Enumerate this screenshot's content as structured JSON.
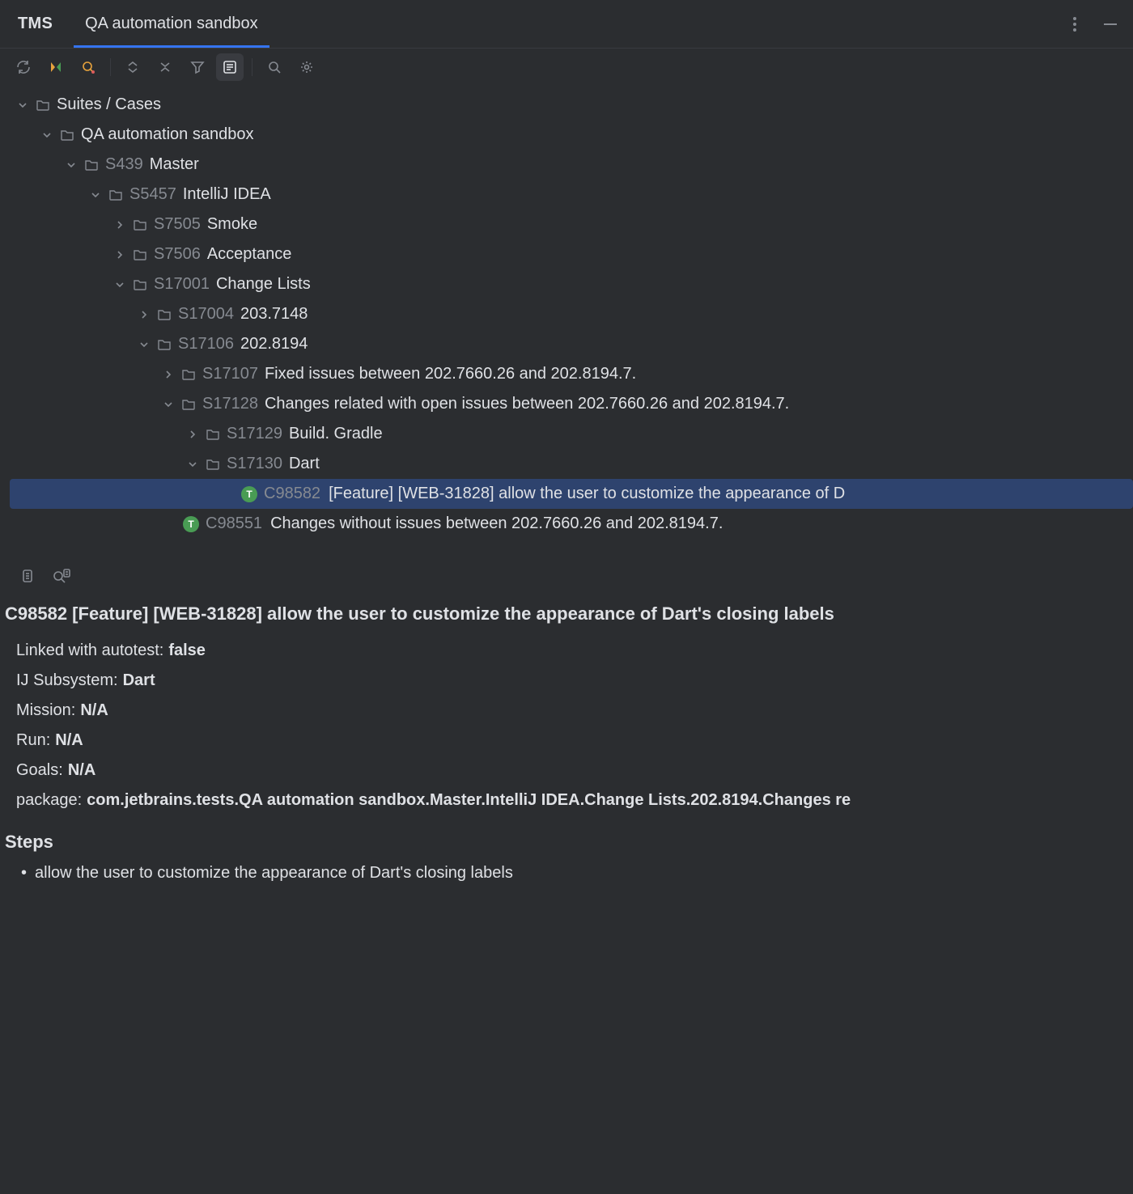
{
  "header": {
    "app": "TMS",
    "tab": "QA automation sandbox"
  },
  "tree": {
    "root_label": "Suites / Cases",
    "project": "QA automation sandbox",
    "nodes": [
      {
        "indent": 2,
        "expanded": true,
        "id": "S439",
        "label": "Master"
      },
      {
        "indent": 3,
        "expanded": true,
        "id": "S5457",
        "label": "IntelliJ IDEA"
      },
      {
        "indent": 4,
        "expanded": false,
        "id": "S7505",
        "label": "Smoke"
      },
      {
        "indent": 4,
        "expanded": false,
        "id": "S7506",
        "label": "Acceptance"
      },
      {
        "indent": 4,
        "expanded": true,
        "id": "S17001",
        "label": "Change Lists"
      },
      {
        "indent": 5,
        "expanded": false,
        "id": "S17004",
        "label": "203.7148"
      },
      {
        "indent": 5,
        "expanded": true,
        "id": "S17106",
        "label": "202.8194"
      },
      {
        "indent": 6,
        "expanded": false,
        "id": "S17107",
        "label": "Fixed issues between 202.7660.26 and 202.8194.7."
      },
      {
        "indent": 6,
        "expanded": true,
        "id": "S17128",
        "label": "Changes related with open issues between 202.7660.26 and 202.8194.7."
      },
      {
        "indent": 7,
        "expanded": false,
        "id": "S17129",
        "label": "Build. Gradle"
      },
      {
        "indent": 7,
        "expanded": true,
        "id": "S17130",
        "label": "Dart"
      },
      {
        "indent": 8,
        "case": true,
        "selected": true,
        "id": "C98582",
        "label": "[Feature] [WEB-31828] allow the user to customize the appearance of D"
      },
      {
        "indent": 6,
        "case": true,
        "id": "C98551",
        "label": "Changes without issues between 202.7660.26 and 202.8194.7."
      }
    ]
  },
  "details": {
    "title": "C98582 [Feature] [WEB-31828] allow the user to customize the appearance of Dart's closing labels",
    "fields": [
      {
        "label": "Linked with autotest:",
        "value": "false"
      },
      {
        "label": "IJ Subsystem:",
        "value": "Dart"
      },
      {
        "label": "Mission:",
        "value": "N/A"
      },
      {
        "label": "Run:",
        "value": "N/A"
      },
      {
        "label": "Goals:",
        "value": "N/A"
      },
      {
        "label": "package:",
        "value": "com.jetbrains.tests.QA automation sandbox.Master.IntelliJ IDEA.Change Lists.202.8194.Changes re"
      }
    ],
    "steps_heading": "Steps",
    "steps": [
      "allow the user to customize the appearance of Dart's closing labels"
    ]
  }
}
